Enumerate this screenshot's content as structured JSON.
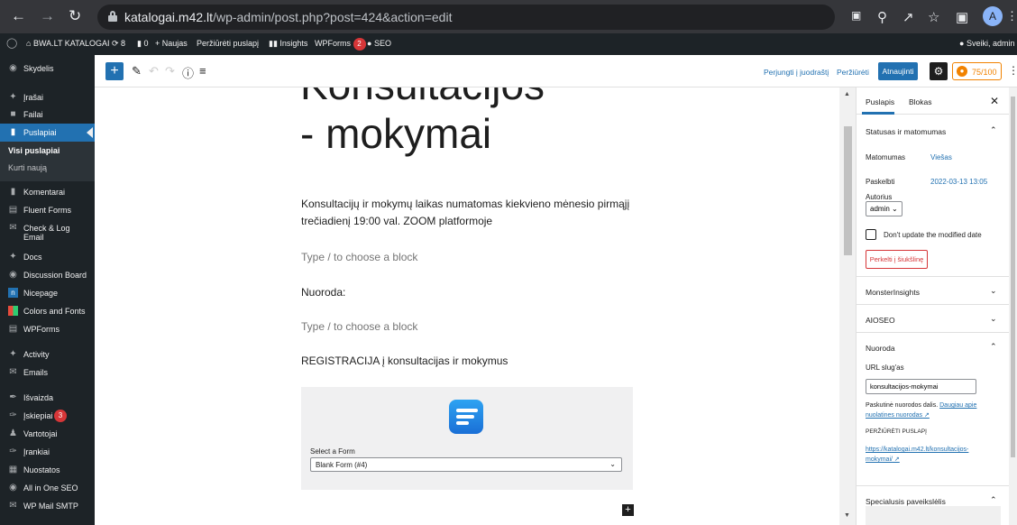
{
  "browser": {
    "url_host": "katalogai.m42.lt",
    "url_path": "/wp-admin/post.php?post=424&action=edit",
    "avatar_letter": "A"
  },
  "adminbar": {
    "site_name": "BWA.LT KATALOGAI",
    "updates_count": "8",
    "comments_count": "0",
    "new_label": "Naujas",
    "view_page": "Peržiūrėti puslapį",
    "insights": "Insights",
    "wpforms": "WPForms",
    "wpforms_badge": "2",
    "seo": "SEO",
    "greeting": "Sveiki, admin"
  },
  "sidebar": {
    "items": [
      {
        "label": "Skydelis",
        "icon": "dashboard-icon"
      },
      {
        "label": "Įrašai",
        "icon": "pin-icon"
      },
      {
        "label": "Failai",
        "icon": "media-icon"
      },
      {
        "label": "Puslapiai",
        "icon": "pages-icon"
      },
      {
        "label": "Komentarai",
        "icon": "comment-icon"
      },
      {
        "label": "Fluent Forms",
        "icon": "forms-icon"
      },
      {
        "label": "Check & Log",
        "label2": "Email",
        "icon": "email-icon"
      },
      {
        "label": "Docs",
        "icon": "pin-icon"
      },
      {
        "label": "Discussion Board",
        "icon": "discussion-icon"
      },
      {
        "label": "Nicepage",
        "icon": "nicepage-icon"
      },
      {
        "label": "Colors and Fonts",
        "icon": "palette-icon"
      },
      {
        "label": "WPForms",
        "icon": "wpforms-icon"
      },
      {
        "label": "Activity",
        "icon": "activity-icon"
      },
      {
        "label": "Emails",
        "icon": "email-icon"
      },
      {
        "label": "Išvaizda",
        "icon": "brush-icon"
      },
      {
        "label": "Įskiepiai",
        "icon": "plugin-icon",
        "badge": "3"
      },
      {
        "label": "Vartotojai",
        "icon": "users-icon"
      },
      {
        "label": "Įrankiai",
        "icon": "tools-icon"
      },
      {
        "label": "Nuostatos",
        "icon": "settings-icon"
      },
      {
        "label": "All in One SEO",
        "icon": "seo-icon"
      },
      {
        "label": "WP Mail SMTP",
        "icon": "mail-smtp-icon"
      }
    ],
    "submenu": {
      "all_pages": "Visi puslapiai",
      "add_new": "Kurti naują"
    }
  },
  "toolbar": {
    "switch_draft": "Perjungti į juodraštį",
    "preview": "Peržiūrėti",
    "update": "Atnaujinti",
    "score": "75/100"
  },
  "content": {
    "title_line1": "Konsultacijos",
    "title_line2": "- mokymai",
    "para1_line1": "Konsultacijų ir mokymų laikas numatomas kiekvieno mėnesio pirmąjį",
    "para1_line2": "trečiadienį 19:00 val. ZOOM platformoje",
    "placeholder1": "Type / to choose a block",
    "nuoroda": "Nuoroda:",
    "placeholder2": "Type / to choose a block",
    "registracija": "REGISTRACIJA į konsultacijas ir mokymus",
    "form_label": "Select a Form",
    "form_selected": "Blank Form (#4)"
  },
  "panel": {
    "tab_page": "Puslapis",
    "tab_block": "Blokas",
    "status_title": "Statusas ir matomumas",
    "visibility_label": "Matomumas",
    "visibility_value": "Viešas",
    "published_label": "Paskelbti",
    "published_value": "2022-03-13 13:05",
    "author_label": "Autorius",
    "author_value": "admin",
    "dont_update": "Don't update the modified date",
    "trash": "Perkelti į šiukšlinę",
    "monsterinsights": "MonsterInsights",
    "aioseo": "AIOSEO",
    "link_title": "Nuoroda",
    "slug_label": "URL slug'as",
    "slug_value": "konsultacijos-mokymai",
    "slug_help": "Paskutinė nuorodos dalis.",
    "slug_help_link1": "Daugiau apie",
    "slug_help_link2": "nuolatines nuorodas",
    "view_page_label": "PERŽIŪRĖTI PUSLAPĮ",
    "page_url1": "https://katalogai.m42.lt/konsultacijos-",
    "page_url2": "mokymai/",
    "featured_image": "Specialusis paveikslėlis"
  }
}
